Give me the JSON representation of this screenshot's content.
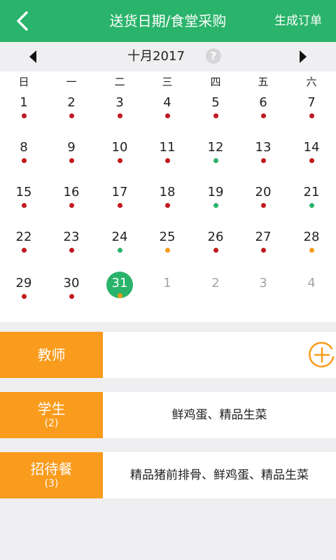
{
  "header": {
    "title": "送货日期/食堂采购",
    "action": "生成订单"
  },
  "calendar": {
    "month": "十月2017",
    "help": "?",
    "weekdays": [
      "日",
      "一",
      "二",
      "三",
      "四",
      "五",
      "六"
    ],
    "weeks": [
      [
        {
          "n": "1",
          "dot": "#c01920"
        },
        {
          "n": "2",
          "dot": "#c01920"
        },
        {
          "n": "3",
          "dot": "#c01920"
        },
        {
          "n": "4",
          "dot": "#c01920"
        },
        {
          "n": "5",
          "dot": "#c01920"
        },
        {
          "n": "6",
          "dot": "#c01920"
        },
        {
          "n": "7",
          "dot": "#c01920"
        }
      ],
      [
        {
          "n": "8",
          "dot": "#c01920"
        },
        {
          "n": "9",
          "dot": "#c01920"
        },
        {
          "n": "10",
          "dot": "#c01920"
        },
        {
          "n": "11",
          "dot": "#c01920"
        },
        {
          "n": "12",
          "dot": "#2ab36a"
        },
        {
          "n": "13",
          "dot": "#c01920"
        },
        {
          "n": "14",
          "dot": "#c01920"
        }
      ],
      [
        {
          "n": "15",
          "dot": "#c01920"
        },
        {
          "n": "16",
          "dot": "#c01920"
        },
        {
          "n": "17",
          "dot": "#c01920"
        },
        {
          "n": "18",
          "dot": "#c01920"
        },
        {
          "n": "19",
          "dot": "#2ab36a"
        },
        {
          "n": "20",
          "dot": "#c01920"
        },
        {
          "n": "21",
          "dot": "#2ab36a"
        }
      ],
      [
        {
          "n": "22",
          "dot": "#c01920"
        },
        {
          "n": "23",
          "dot": "#c01920"
        },
        {
          "n": "24",
          "dot": "#2ab36a"
        },
        {
          "n": "25",
          "dot": "#f09b1c"
        },
        {
          "n": "26",
          "dot": "#c01920"
        },
        {
          "n": "27",
          "dot": "#c01920"
        },
        {
          "n": "28",
          "dot": "#f09b1c"
        }
      ],
      [
        {
          "n": "29",
          "dot": "#c01920"
        },
        {
          "n": "30",
          "dot": "#c01920"
        },
        {
          "n": "31",
          "dot": "#f09b1c",
          "selected": true
        },
        {
          "n": "1",
          "other": true
        },
        {
          "n": "2",
          "other": true
        },
        {
          "n": "3",
          "other": true
        },
        {
          "n": "4",
          "other": true
        }
      ]
    ]
  },
  "groups": [
    {
      "name": "教师",
      "count": "",
      "items": ""
    },
    {
      "name": "学生",
      "count": "(2)",
      "items": "鲜鸡蛋、精品生菜"
    },
    {
      "name": "招待餐",
      "count": "(3)",
      "items": "精品猪前排骨、鲜鸡蛋、精品生菜"
    }
  ],
  "colors": {
    "header": "#2ab36a",
    "category": "#f99b1c",
    "selected": "#2ab36a"
  }
}
